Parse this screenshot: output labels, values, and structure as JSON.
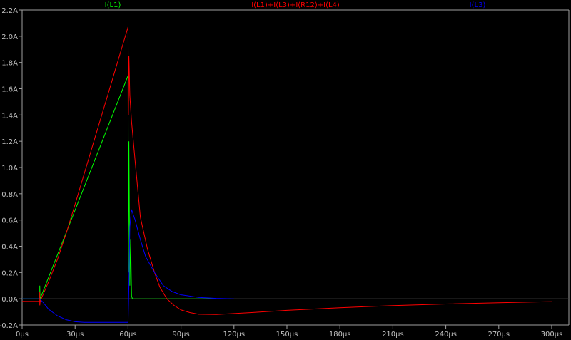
{
  "chart_data": {
    "type": "line",
    "title": "",
    "xlabel": "",
    "ylabel": "",
    "xlim": [
      0,
      300
    ],
    "ylim": [
      -0.2,
      2.2
    ],
    "x_unit": "µs",
    "y_unit": "A",
    "x_ticks": [
      "0µs",
      "30µs",
      "60µs",
      "90µs",
      "120µs",
      "150µs",
      "180µs",
      "210µs",
      "240µs",
      "270µs",
      "300µs"
    ],
    "x_tick_values": [
      0,
      30,
      60,
      90,
      120,
      150,
      180,
      210,
      240,
      270,
      300
    ],
    "y_ticks": [
      "-0.2A",
      "0.0A",
      "0.2A",
      "0.4A",
      "0.6A",
      "0.8A",
      "1.0A",
      "1.2A",
      "1.4A",
      "1.6A",
      "1.8A",
      "2.0A",
      "2.2A"
    ],
    "y_tick_values": [
      -0.2,
      0,
      0.2,
      0.4,
      0.6,
      0.8,
      1.0,
      1.2,
      1.4,
      1.6,
      1.8,
      2.0,
      2.2
    ],
    "grid": false,
    "background": "#000000",
    "legend_placement": "top",
    "series": [
      {
        "name": "I(L1)",
        "color": "#00ff00",
        "points": [
          [
            0,
            0
          ],
          [
            10,
            0
          ],
          [
            10,
            0.1
          ],
          [
            10.2,
            0.0
          ],
          [
            60,
            1.7
          ],
          [
            60.2,
            0.2
          ],
          [
            60.5,
            1.2
          ],
          [
            61,
            0.1
          ],
          [
            61.5,
            0.45
          ],
          [
            62,
            0.02
          ],
          [
            62.5,
            0
          ],
          [
            118,
            0
          ]
        ]
      },
      {
        "name": "I(L1)+I(L3)+I(R12)+I(L4)",
        "color": "#ff0000",
        "points": [
          [
            0,
            -0.02
          ],
          [
            10,
            -0.02
          ],
          [
            10,
            0.05
          ],
          [
            10,
            -0.05
          ],
          [
            10.2,
            -0.02
          ],
          [
            15,
            0.13
          ],
          [
            20,
            0.3
          ],
          [
            25,
            0.5
          ],
          [
            30,
            0.72
          ],
          [
            40,
            1.17
          ],
          [
            50,
            1.62
          ],
          [
            60,
            2.07
          ],
          [
            60.2,
            1.4
          ],
          [
            60.5,
            1.85
          ],
          [
            61,
            1.55
          ],
          [
            62,
            1.35
          ],
          [
            64,
            1.05
          ],
          [
            67,
            0.62
          ],
          [
            71,
            0.38
          ],
          [
            75,
            0.2
          ],
          [
            78,
            0.09
          ],
          [
            82,
            0
          ],
          [
            86,
            -0.05
          ],
          [
            90,
            -0.085
          ],
          [
            95,
            -0.105
          ],
          [
            100,
            -0.118
          ],
          [
            110,
            -0.12
          ],
          [
            130,
            -0.105
          ],
          [
            150,
            -0.088
          ],
          [
            180,
            -0.068
          ],
          [
            210,
            -0.052
          ],
          [
            240,
            -0.04
          ],
          [
            270,
            -0.03
          ],
          [
            300,
            -0.022
          ]
        ]
      },
      {
        "name": "I(L3)",
        "color": "#0000ff",
        "points": [
          [
            0,
            0
          ],
          [
            10,
            0
          ],
          [
            12,
            -0.03
          ],
          [
            15,
            -0.08
          ],
          [
            20,
            -0.13
          ],
          [
            25,
            -0.16
          ],
          [
            30,
            -0.175
          ],
          [
            35,
            -0.18
          ],
          [
            60,
            -0.18
          ],
          [
            60.5,
            0.1
          ],
          [
            61,
            0.55
          ],
          [
            62,
            0.68
          ],
          [
            64,
            0.6
          ],
          [
            67,
            0.45
          ],
          [
            70,
            0.32
          ],
          [
            75,
            0.2
          ],
          [
            80,
            0.1
          ],
          [
            85,
            0.055
          ],
          [
            90,
            0.03
          ],
          [
            100,
            0.01
          ],
          [
            110,
            0.003
          ],
          [
            120,
            0
          ]
        ]
      }
    ]
  }
}
